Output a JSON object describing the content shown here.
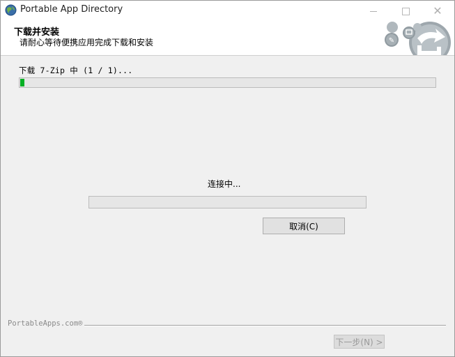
{
  "window": {
    "title": "Portable App Directory",
    "icon": "globe-icon",
    "controls": {
      "minimize": "minimize-icon",
      "maximize": "maximize-icon",
      "close": "close-icon"
    }
  },
  "header": {
    "title": "下载并安装",
    "subtitle": "请耐心等待便携应用完成下载和安装",
    "graphic": "portableapps-logo"
  },
  "download": {
    "status_text": "下载 7-Zip 中 (1 / 1)...",
    "progress": 0.01
  },
  "connection": {
    "status_text": "连接中...",
    "progress": 0.0
  },
  "buttons": {
    "cancel": "取消(C)",
    "next": "下一步(N) >"
  },
  "footer": {
    "brand": "PortableApps.com®"
  },
  "colors": {
    "progress_fill": "#06b025",
    "window_bg": "#f0f0f0",
    "header_bg": "#ffffff"
  }
}
